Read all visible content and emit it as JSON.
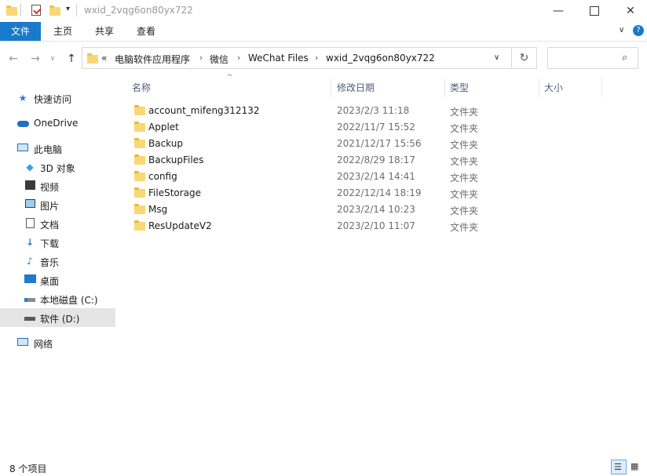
{
  "window": {
    "title": "wxid_2vqg6on80yx722",
    "minimize_icon": "minimize-icon",
    "maximize_icon": "maximize-icon",
    "close_icon": "close-icon"
  },
  "ribbon": {
    "tabs": [
      {
        "label": "文件"
      },
      {
        "label": "主页"
      },
      {
        "label": "共享"
      },
      {
        "label": "查看"
      }
    ],
    "accent": "#1979ca"
  },
  "address": {
    "overflow": "«",
    "crumbs": [
      "电脑软件应用程序",
      "微信",
      "WeChat Files",
      "wxid_2vqg6on80yx722"
    ]
  },
  "sidebar": {
    "items": [
      {
        "label": "快速访问",
        "icon": "star-icon"
      },
      {
        "label": "OneDrive",
        "icon": "cloud-icon"
      },
      {
        "label": "此电脑",
        "icon": "computer-icon"
      },
      {
        "label": "3D 对象",
        "icon": "3d-objects-icon"
      },
      {
        "label": "视频",
        "icon": "video-icon"
      },
      {
        "label": "图片",
        "icon": "pictures-icon"
      },
      {
        "label": "文档",
        "icon": "documents-icon"
      },
      {
        "label": "下载",
        "icon": "download-icon"
      },
      {
        "label": "音乐",
        "icon": "music-icon"
      },
      {
        "label": "桌面",
        "icon": "desktop-icon"
      },
      {
        "label": "本地磁盘 (C:)",
        "icon": "drive-icon"
      },
      {
        "label": "软件 (D:)",
        "icon": "drive-icon"
      },
      {
        "label": "网络",
        "icon": "network-icon"
      }
    ]
  },
  "columns": {
    "name": "名称",
    "date": "修改日期",
    "type": "类型",
    "size": "大小"
  },
  "files": [
    {
      "name": "account_mifeng312132",
      "date": "2023/2/3 11:18",
      "type": "文件夹"
    },
    {
      "name": "Applet",
      "date": "2022/11/7 15:52",
      "type": "文件夹"
    },
    {
      "name": "Backup",
      "date": "2021/12/17 15:56",
      "type": "文件夹"
    },
    {
      "name": "BackupFiles",
      "date": "2022/8/29 18:17",
      "type": "文件夹"
    },
    {
      "name": "config",
      "date": "2023/2/14 14:41",
      "type": "文件夹"
    },
    {
      "name": "FileStorage",
      "date": "2022/12/14 18:19",
      "type": "文件夹"
    },
    {
      "name": "Msg",
      "date": "2023/2/14 10:23",
      "type": "文件夹"
    },
    {
      "name": "ResUpdateV2",
      "date": "2023/2/10 11:07",
      "type": "文件夹"
    }
  ],
  "status": {
    "count": "8 个项目"
  }
}
